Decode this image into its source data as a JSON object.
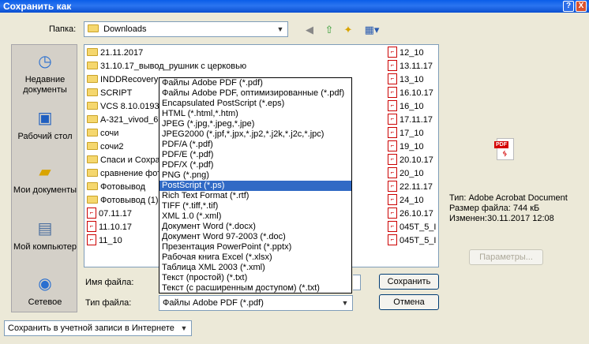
{
  "window": {
    "title": "Сохранить как",
    "help": "?",
    "close": "X"
  },
  "folder": {
    "label": "Папка:",
    "value": "Downloads"
  },
  "places": [
    {
      "name": "place-recent",
      "label": "Недавние документы",
      "icon": "clock-icon"
    },
    {
      "name": "place-desktop",
      "label": "Рабочий стол",
      "icon": "desktop-icon"
    },
    {
      "name": "place-mydocs",
      "label": "Мои документы",
      "icon": "folder-docs-icon"
    },
    {
      "name": "place-mycomputer",
      "label": "Мой компьютер",
      "icon": "computer-icon"
    },
    {
      "name": "place-network",
      "label": "Сетевое",
      "icon": "network-icon"
    }
  ],
  "files_col1": [
    {
      "type": "folder",
      "name": "21.11.2017"
    },
    {
      "type": "folder",
      "name": "31.10.17_вывод_рушник с церковью"
    },
    {
      "type": "folder",
      "name": "INDDRecovery (1)"
    },
    {
      "type": "folder",
      "name": "SCRIPT"
    },
    {
      "type": "folder",
      "name": "VCS 8.10.0193"
    },
    {
      "type": "folder",
      "name": "А-321_vivod_6"
    },
    {
      "type": "folder",
      "name": "сочи"
    },
    {
      "type": "folder",
      "name": "сочи2"
    },
    {
      "type": "folder",
      "name": "Спаси и Сохрани"
    },
    {
      "type": "folder",
      "name": "сравнение фот"
    },
    {
      "type": "folder",
      "name": "Фотовывод"
    },
    {
      "type": "folder",
      "name": "Фотовывод (1)"
    },
    {
      "type": "pdf",
      "name": "07.11.17"
    },
    {
      "type": "pdf",
      "name": "11.10.17"
    },
    {
      "type": "pdf",
      "name": "11_10"
    }
  ],
  "files_col2": [
    "12_10",
    "13.11.17",
    "13_10",
    "16.10.17",
    "16_10",
    "17.11.17",
    "17_10",
    "19_10",
    "20.10.17",
    "20_10",
    "22.11.17",
    "24_10",
    "26.10.17",
    "045T_5_I",
    "045T_5_I"
  ],
  "filetype_options": [
    "Файлы Adobe PDF (*.pdf)",
    "Файлы Adobe PDF, оптимизированные (*.pdf)",
    "Encapsulated PostScript (*.eps)",
    "HTML (*.html,*.htm)",
    "JPEG (*.jpg,*.jpeg,*.jpe)",
    "JPEG2000 (*.jpf,*.jpx,*.jp2,*.j2k,*.j2c,*.jpc)",
    "PDF/A (*.pdf)",
    "PDF/E (*.pdf)",
    "PDF/X (*.pdf)",
    "PNG (*.png)",
    "PostScript (*.ps)",
    "Rich Text Format (*.rtf)",
    "TIFF (*.tiff,*.tif)",
    "XML 1.0 (*.xml)",
    "Документ Word (*.docx)",
    "Документ Word 97-2003 (*.doc)",
    "Презентация PowerPoint (*.pptx)",
    "Рабочая книга Excel (*.xlsx)",
    "Таблица XML 2003 (*.xml)",
    "Текст (простой) (*.txt)",
    "Текст (с расширенным доступом) (*.txt)"
  ],
  "selected_option_index": 10,
  "filename": {
    "label": "Имя файла:",
    "value": ""
  },
  "filetype": {
    "label": "Тип файла:",
    "value": "Файлы Adobe PDF (*.pdf)"
  },
  "buttons": {
    "save": "Сохранить",
    "cancel": "Отмена",
    "params": "Параметры..."
  },
  "info": {
    "type": "Тип: Adobe Acrobat Document",
    "size": "Размер файла: 744 кБ",
    "modified": "Изменен:30.11.2017 12:08"
  },
  "online_save": "Сохранить в учетной записи в Интернете",
  "pdf_badge": "PDF"
}
